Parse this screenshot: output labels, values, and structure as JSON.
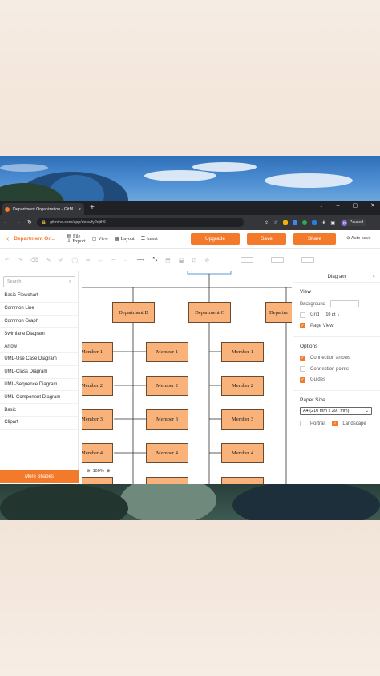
{
  "browser": {
    "tab_title": "Department Organization - GitM",
    "tab_close": "×",
    "new_tab": "+",
    "url": "gitmind.com/app/docs/fy2xjth6",
    "profile_initial": "R",
    "profile_status": "Paused",
    "window_controls": [
      "⌄",
      "–",
      "▢",
      "✕"
    ]
  },
  "app": {
    "doc_title": "Department Or...",
    "menu": {
      "file": "File",
      "export": "Export",
      "view": "View",
      "layout": "Layout",
      "insert": "Insert"
    },
    "buttons": {
      "upgrade": "Upgrade",
      "save": "Save",
      "share": "Share"
    },
    "autosave": "Auto-save",
    "accent_color": "#f47a2b"
  },
  "sidebar": {
    "search_placeholder": "Search",
    "categories": [
      "Basic Flowchart",
      "Common Line",
      "Common Graph",
      "Swimlane Diagram",
      "Arrow",
      "UML-Use Case Diagram",
      "UML-Class Diagram",
      "UML-Sequence Diagram",
      "UML-Component Diagram",
      "Basic",
      "Clipart"
    ],
    "more_shapes": "More Shapes"
  },
  "canvas": {
    "departments": [
      "Department B",
      "Department C",
      "Departm"
    ],
    "members": [
      "Member 1",
      "Member 2",
      "Member 3",
      "Member 4"
    ],
    "zoom": "100%"
  },
  "panel": {
    "title": "Diagram",
    "view_title": "View",
    "background_label": "Background",
    "grid_label": "Grid",
    "grid_size": "10 pt",
    "pageview_label": "Page View",
    "options_title": "Options",
    "connection_arrows": "Connection arrows",
    "connection_points": "Connection points",
    "guides": "Guides",
    "paper_size_title": "Paper Size",
    "paper_size_value": "A4 (210 mm x 297 mm)",
    "portrait": "Portrait",
    "landscape": "Landscape"
  }
}
